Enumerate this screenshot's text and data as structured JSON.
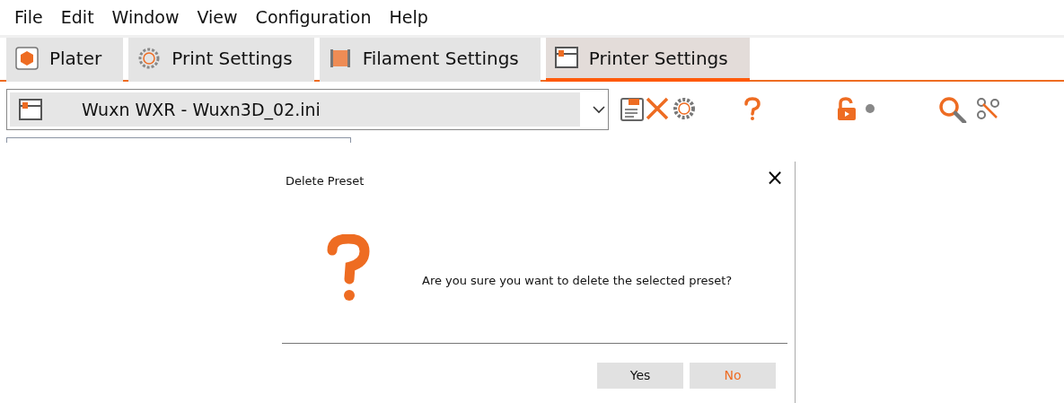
{
  "menu": [
    "File",
    "Edit",
    "Window",
    "View",
    "Configuration",
    "Help"
  ],
  "tabs": [
    {
      "label": "Plater",
      "selected": false
    },
    {
      "label": "Print Settings",
      "selected": false
    },
    {
      "label": "Filament Settings",
      "selected": false
    },
    {
      "label": "Printer Settings",
      "selected": true
    }
  ],
  "preset": {
    "value": "Wuxn WXR - Wuxn3D_02.ini"
  },
  "dialog": {
    "title": "Delete Preset",
    "close": "×",
    "message": "Are you sure you want to delete the selected preset?",
    "buttons": [
      {
        "label": "Yes",
        "focused": false
      },
      {
        "label": "No",
        "focused": true
      }
    ]
  }
}
